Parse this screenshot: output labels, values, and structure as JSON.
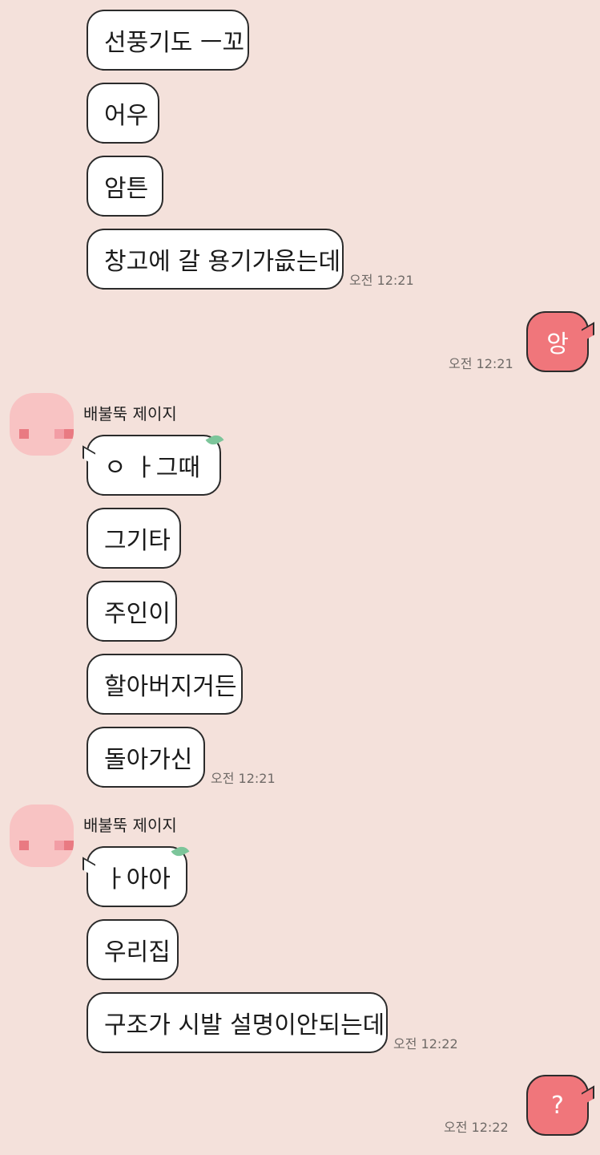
{
  "incoming_1": {
    "messages": [
      "선풍기도 ㅡ꼬",
      "어우",
      "암튼",
      "창고에 갈 용기가읎는데"
    ],
    "time": "오전 12:21"
  },
  "outgoing_1": {
    "text": "앙",
    "time": "오전 12:21"
  },
  "group_2": {
    "sender": "배불뚝 제이지",
    "messages": [
      "ㅇ ㅏ그때",
      "그기타",
      "주인이",
      "할아버지거든",
      "돌아가신"
    ],
    "time": "오전 12:21"
  },
  "group_3": {
    "sender": "배불뚝 제이지",
    "messages": [
      "ㅏ아아",
      "우리집",
      "구조가 시발 설명이안되는데"
    ],
    "time": "오전 12:22"
  },
  "outgoing_2": {
    "text": "?",
    "time": "오전 12:22"
  },
  "colors": {
    "background": "#f4e1db",
    "bubble_incoming": "#ffffff",
    "bubble_outgoing": "#f0767b",
    "avatar": "#f8c3c3",
    "leaf": "#7cc59a"
  },
  "icons": {
    "avatar": "pixelated-profile-avatar",
    "decoration": "leaf-icon"
  }
}
